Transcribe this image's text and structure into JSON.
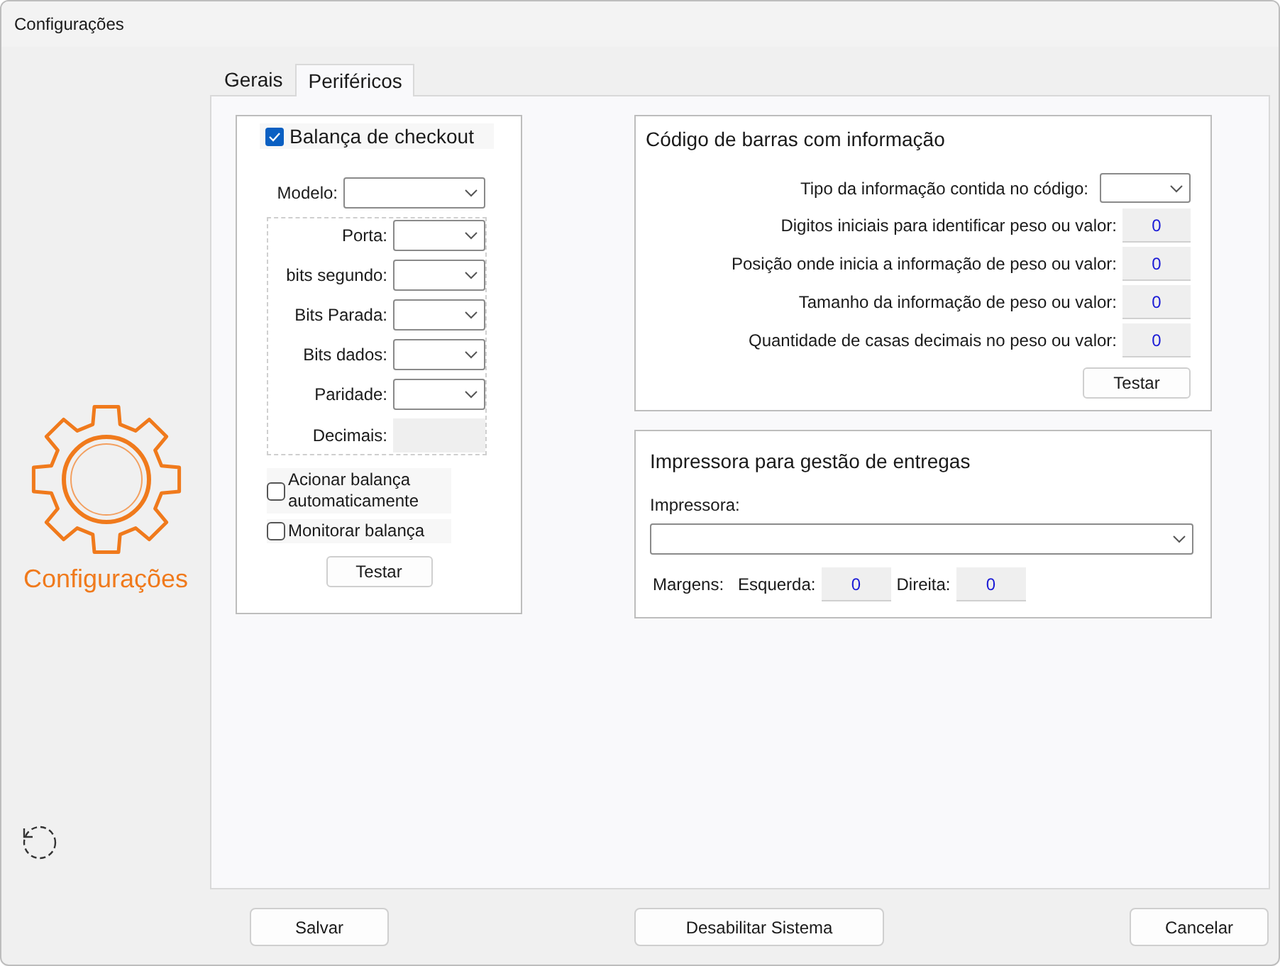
{
  "window": {
    "title": "Configurações"
  },
  "sidebar": {
    "title": "Configurações"
  },
  "tabs": [
    {
      "label": "Gerais",
      "selected": false
    },
    {
      "label": "Periféricos",
      "selected": true
    }
  ],
  "scale": {
    "title": "Balança de checkout",
    "checked": true,
    "model_label": "Modelo:",
    "serial_fields": [
      {
        "label": "Porta:",
        "kind": "select"
      },
      {
        "label": "bits segundo:",
        "kind": "select"
      },
      {
        "label": "Bits Parada:",
        "kind": "select"
      },
      {
        "label": "Bits dados:",
        "kind": "select"
      },
      {
        "label": "Paridade:",
        "kind": "select"
      },
      {
        "label": "Decimais:",
        "kind": "disabled"
      }
    ],
    "options": [
      {
        "label": "Acionar balança automaticamente",
        "checked": false
      },
      {
        "label": "Monitorar balança",
        "checked": false
      }
    ],
    "test_button": "Testar"
  },
  "barcode": {
    "title": "Código de barras com informação",
    "type_label": "Tipo da informação contida no código:",
    "fields": [
      {
        "label": "Digitos iniciais para identificar peso ou valor:",
        "value": "0"
      },
      {
        "label": "Posição onde inicia a informação de peso ou valor:",
        "value": "0"
      },
      {
        "label": "Tamanho da informação de peso ou valor:",
        "value": "0"
      },
      {
        "label": "Quantidade de casas decimais no peso ou valor:",
        "value": "0"
      }
    ],
    "test_button": "Testar"
  },
  "printer": {
    "title": "Impressora para gestão de entregas",
    "printer_label": "Impressora:",
    "margins_label": "Margens:",
    "margins": [
      {
        "label": "Esquerda:",
        "value": "0"
      },
      {
        "label": "Direita:",
        "value": "0"
      }
    ]
  },
  "buttons": [
    "Salvar",
    "Desabilitar Sistema",
    "Cancelar"
  ]
}
